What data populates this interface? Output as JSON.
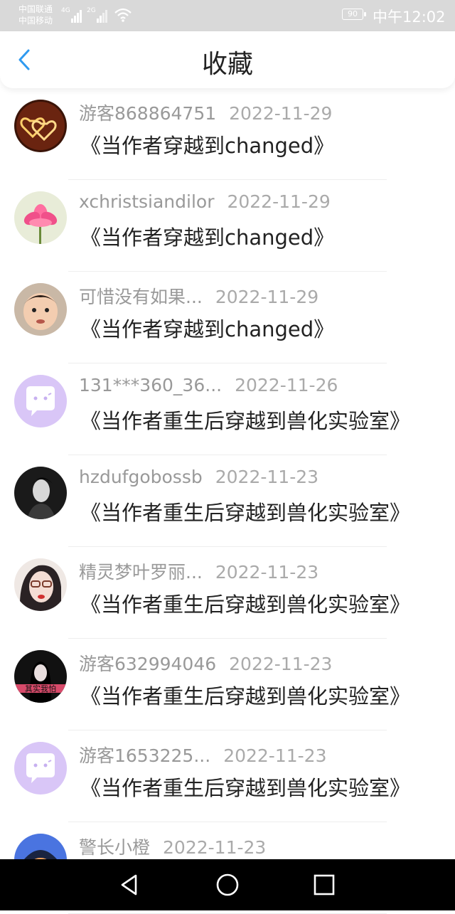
{
  "status_bar": {
    "carrier1": "中国联通",
    "carrier2": "中国移动",
    "net1": "4G",
    "net2": "2G",
    "battery": "90",
    "time": "中午12:02"
  },
  "header": {
    "title": "收藏",
    "back_icon": "chevron-left-icon",
    "accent": "#2f9af0"
  },
  "favorites": [
    {
      "name": "游客868864751",
      "date": "2022-11-29",
      "book": "《当作者穿越到changed》",
      "avatar": "hearts"
    },
    {
      "name": "xchristsiandilor",
      "date": "2022-11-29",
      "book": "《当作者穿越到changed》",
      "avatar": "lotus"
    },
    {
      "name": "可惜没有如果...",
      "date": "2022-11-29",
      "book": "《当作者穿越到changed》",
      "avatar": "child"
    },
    {
      "name": "131***360_36...",
      "date": "2022-11-26",
      "book": "《当作者重生后穿越到兽化实验室》",
      "avatar": "default-chat"
    },
    {
      "name": "hzdufgobossb",
      "date": "2022-11-23",
      "book": "《当作者重生后穿越到兽化实验室》",
      "avatar": "man-bw"
    },
    {
      "name": "精灵梦叶罗丽...",
      "date": "2022-11-23",
      "book": "《当作者重生后穿越到兽化实验室》",
      "avatar": "girl-glasses"
    },
    {
      "name": "游客632994046",
      "date": "2022-11-23",
      "book": "《当作者重生后穿越到兽化实验室》",
      "avatar": "girl-dark",
      "avatar_text": "其实我怕"
    },
    {
      "name": "游客1653225...",
      "date": "2022-11-23",
      "book": "《当作者重生后穿越到兽化实验室》",
      "avatar": "default-chat"
    },
    {
      "name": "警长小橙",
      "date": "2022-11-23",
      "book": "",
      "avatar": "cartoon"
    }
  ],
  "nav": {
    "back": "triangle-back-icon",
    "home": "circle-home-icon",
    "recent": "square-recent-icon"
  }
}
